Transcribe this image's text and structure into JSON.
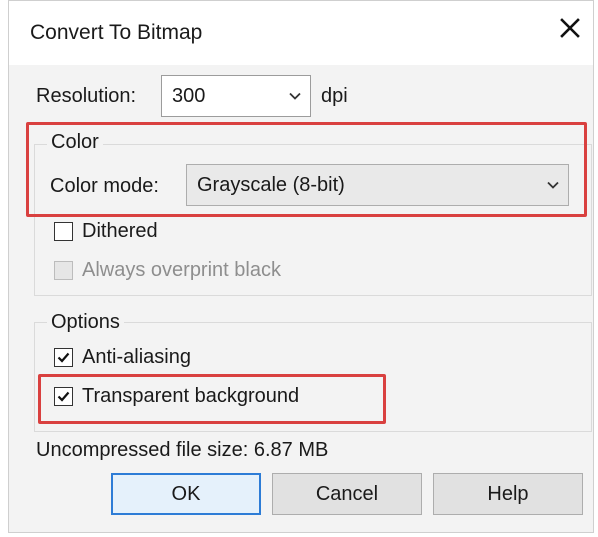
{
  "dialog": {
    "title": "Convert To Bitmap",
    "close_icon": "close-icon"
  },
  "resolution": {
    "label": "Resolution:",
    "value": "300",
    "unit": "dpi"
  },
  "color_group": {
    "legend": "Color",
    "mode_label": "Color mode:",
    "mode_value": "Grayscale (8-bit)",
    "dithered": {
      "label": "Dithered",
      "checked": false
    },
    "always_overprint_black": {
      "label": "Always overprint black",
      "checked": false,
      "enabled": false
    }
  },
  "options_group": {
    "legend": "Options",
    "anti_aliasing": {
      "label": "Anti-aliasing",
      "checked": true
    },
    "transparent_background": {
      "label": "Transparent background",
      "checked": true
    }
  },
  "file_size": "Uncompressed file size: 6.87 MB",
  "buttons": {
    "ok": "OK",
    "cancel": "Cancel",
    "help": "Help"
  },
  "colors": {
    "highlight": "#d9403f",
    "default_button_border": "#2d7cd6"
  }
}
